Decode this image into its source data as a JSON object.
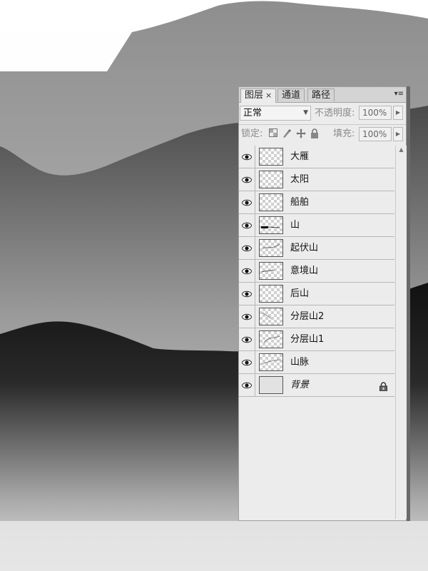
{
  "panel": {
    "tabs": [
      {
        "label": "图层",
        "close": "×"
      },
      {
        "label": "通道"
      },
      {
        "label": "路径"
      }
    ],
    "menu_glyph": "▾≡",
    "blend_mode": "正常",
    "opacity_label": "不透明度:",
    "opacity_value": "100%",
    "lock_label": "锁定:",
    "fill_label": "填充:",
    "fill_value": "100%"
  },
  "layers": [
    {
      "name": "大雁",
      "visible": true
    },
    {
      "name": "太阳",
      "visible": true
    },
    {
      "name": "船舶",
      "visible": true
    },
    {
      "name": "山",
      "visible": true
    },
    {
      "name": "起伏山",
      "visible": true
    },
    {
      "name": "意境山",
      "visible": true
    },
    {
      "name": "后山",
      "visible": true
    },
    {
      "name": "分层山2",
      "visible": true
    },
    {
      "name": "分层山1",
      "visible": true
    },
    {
      "name": "山脉",
      "visible": true
    },
    {
      "name": "背景",
      "visible": true,
      "locked": true
    }
  ],
  "icons": {
    "eye": "eye-icon",
    "lock": "lock-icon",
    "lock_transparent": "lock-transparent-icon",
    "lock_brush": "brush-icon",
    "lock_move": "move-icon"
  }
}
